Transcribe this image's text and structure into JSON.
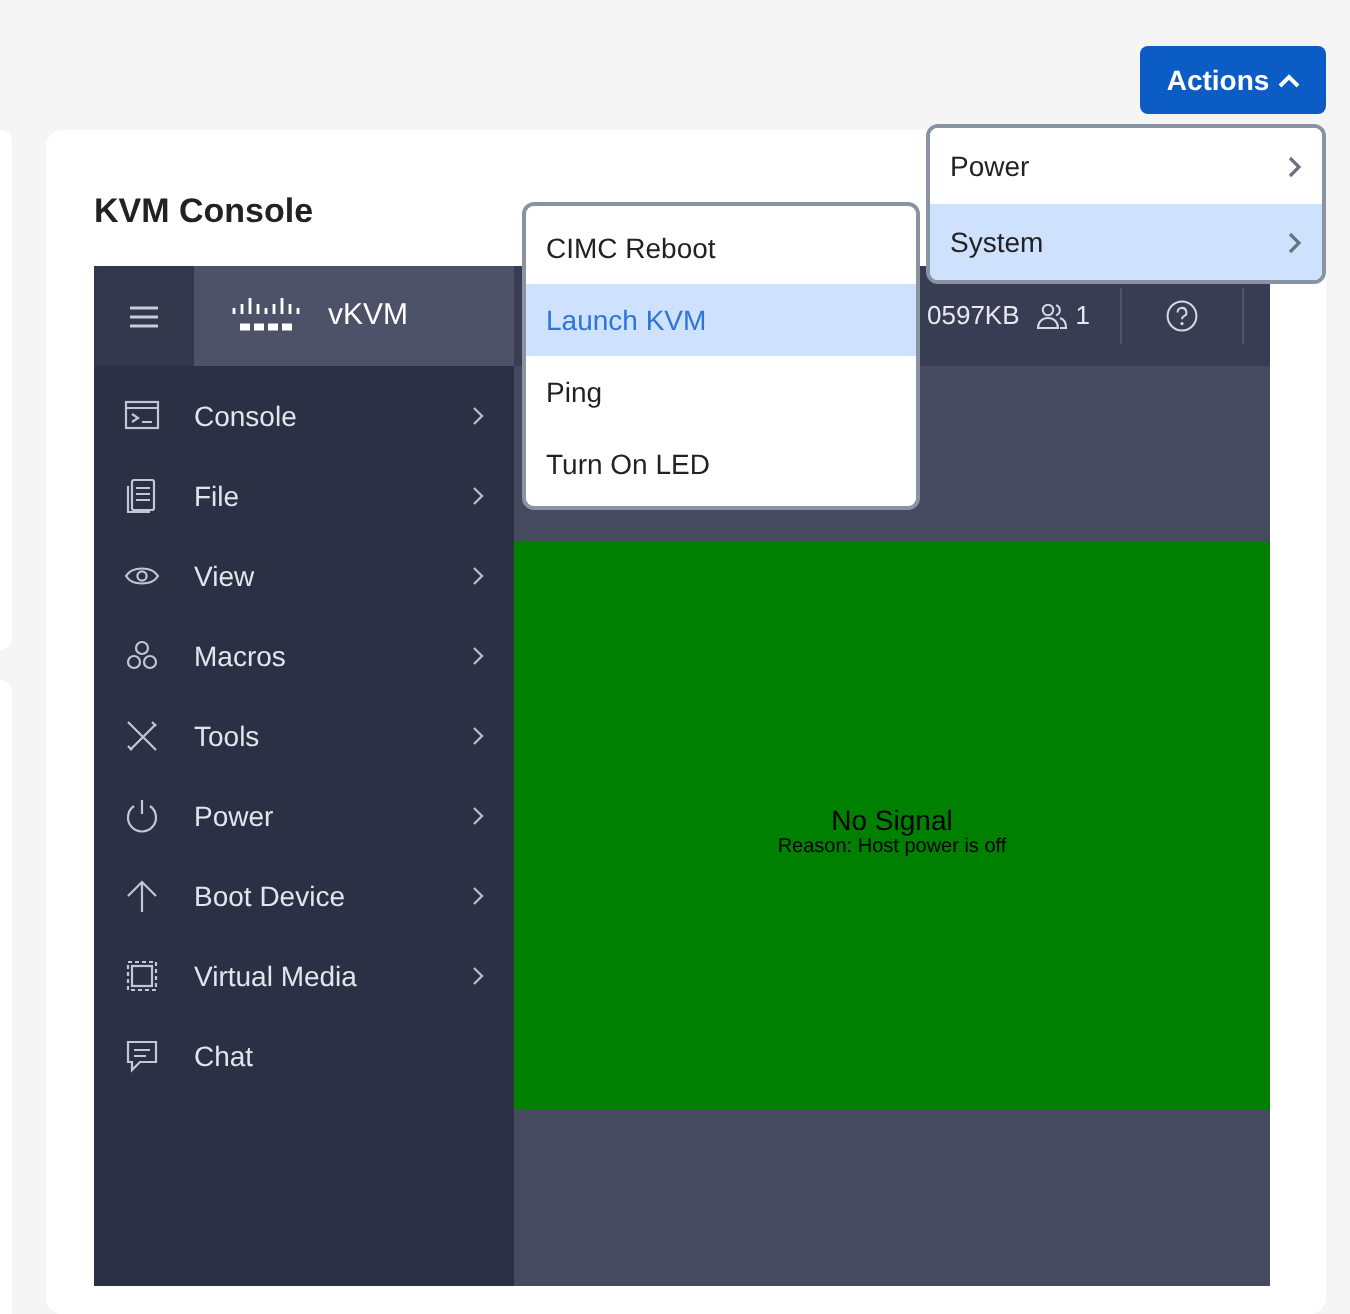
{
  "actions_button": {
    "label": "Actions",
    "expanded": true
  },
  "actions_menu": [
    {
      "label": "Power",
      "selected": false
    },
    {
      "label": "System",
      "selected": true
    }
  ],
  "system_submenu": [
    {
      "label": "CIMC Reboot",
      "selected": false
    },
    {
      "label": "Launch KVM",
      "selected": true
    },
    {
      "label": "Ping",
      "selected": false
    },
    {
      "label": "Turn On LED",
      "selected": false
    }
  ],
  "card": {
    "title": "KVM Console"
  },
  "kvm": {
    "header": {
      "product": "vKVM",
      "data_rate": "0597KB",
      "users": "1"
    },
    "sidebar": [
      {
        "label": "Console",
        "has_submenu": true
      },
      {
        "label": "File",
        "has_submenu": true
      },
      {
        "label": "View",
        "has_submenu": true
      },
      {
        "label": "Macros",
        "has_submenu": true
      },
      {
        "label": "Tools",
        "has_submenu": true
      },
      {
        "label": "Power",
        "has_submenu": true
      },
      {
        "label": "Boot Device",
        "has_submenu": true
      },
      {
        "label": "Virtual Media",
        "has_submenu": true
      },
      {
        "label": "Chat",
        "has_submenu": false
      }
    ],
    "screen": {
      "message": "No Signal",
      "reason": "Reason: Host power is off"
    }
  }
}
